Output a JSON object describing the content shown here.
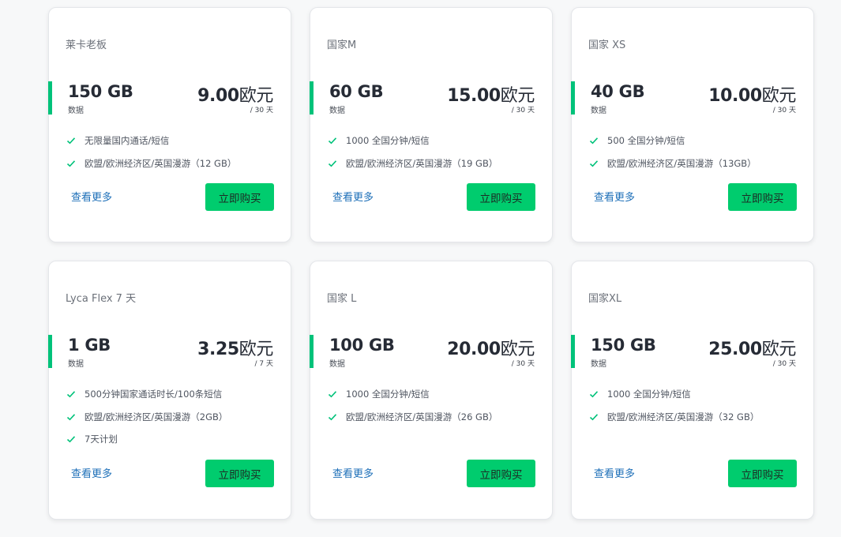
{
  "plans": [
    {
      "name": "莱卡老板",
      "data": "150 GB",
      "data_label": "数据",
      "price": "9.00",
      "currency": "欧元",
      "period": "/ 30 天",
      "features": [
        "无限量国内通话/短信",
        "欧盟/欧洲经济区/英国漫游（12 GB）"
      ],
      "more": "查看更多",
      "buy": "立即购买"
    },
    {
      "name": "国家M",
      "data": "60 GB",
      "data_label": "数据",
      "price": "15.00",
      "currency": "欧元",
      "period": "/ 30 天",
      "features": [
        "1000 全国分钟/短信",
        "欧盟/欧洲经济区/英国漫游（19 GB）"
      ],
      "more": "查看更多",
      "buy": "立即购买"
    },
    {
      "name": "国家 XS",
      "data": "40 GB",
      "data_label": "数据",
      "price": "10.00",
      "currency": "欧元",
      "period": "/ 30 天",
      "features": [
        "500 全国分钟/短信",
        "欧盟/欧洲经济区/英国漫游（13GB）"
      ],
      "more": "查看更多",
      "buy": "立即购买"
    },
    {
      "name": "Lyca Flex 7 天",
      "data": "1 GB",
      "data_label": "数据",
      "price": "3.25",
      "currency": "欧元",
      "period": "/ 7 天",
      "features": [
        "500分钟国家通话时长/100条短信",
        "欧盟/欧洲经济区/英国漫游（2GB）",
        "7天计划"
      ],
      "more": "查看更多",
      "buy": "立即购买"
    },
    {
      "name": "国家 L",
      "data": "100 GB",
      "data_label": "数据",
      "price": "20.00",
      "currency": "欧元",
      "period": "/ 30 天",
      "features": [
        "1000 全国分钟/短信",
        "欧盟/欧洲经济区/英国漫游（26 GB）"
      ],
      "more": "查看更多",
      "buy": "立即购买"
    },
    {
      "name": "国家XL",
      "data": "150 GB",
      "data_label": "数据",
      "price": "25.00",
      "currency": "欧元",
      "period": "/ 30 天",
      "features": [
        "1000 全国分钟/短信",
        "欧盟/欧洲经济区/英国漫游（32 GB）"
      ],
      "more": "查看更多",
      "buy": "立即购买"
    }
  ],
  "colors": {
    "accent": "#00c27a",
    "button": "#00cc6e",
    "link": "#1d6fb8"
  },
  "icons": {
    "feature": "check-icon"
  }
}
